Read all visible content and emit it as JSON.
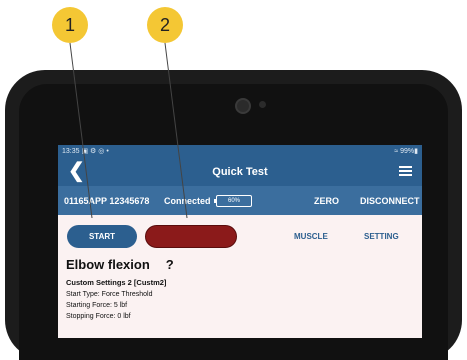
{
  "callouts": [
    "1",
    "2"
  ],
  "status_bar": {
    "time": "13:35",
    "icons_left": "▣ ⚙ ◎ •",
    "right": "≈ 99%▮"
  },
  "title_bar": {
    "title": "Quick Test"
  },
  "device_bar": {
    "device_id": "01165APP 12345678",
    "connection": "Connected",
    "battery": "60%",
    "zero_label": "ZERO",
    "disconnect_label": "DISCONNECT"
  },
  "action_bar": {
    "start_label": "START",
    "muscle_label": "MUSCLE",
    "setting_label": "SETTING"
  },
  "content": {
    "muscle_name": "Elbow flexion",
    "help": "?",
    "settings_name": "Custom Settings 2 [Custm2]",
    "lines": [
      "Start Type: Force Threshold",
      "Starting Force: 5 lbf",
      "Stopping Force: 0 lbf"
    ]
  },
  "colors": {
    "header": "#2c5f8f",
    "stop_button": "#8b1a1a",
    "callout": "#f4c734"
  }
}
